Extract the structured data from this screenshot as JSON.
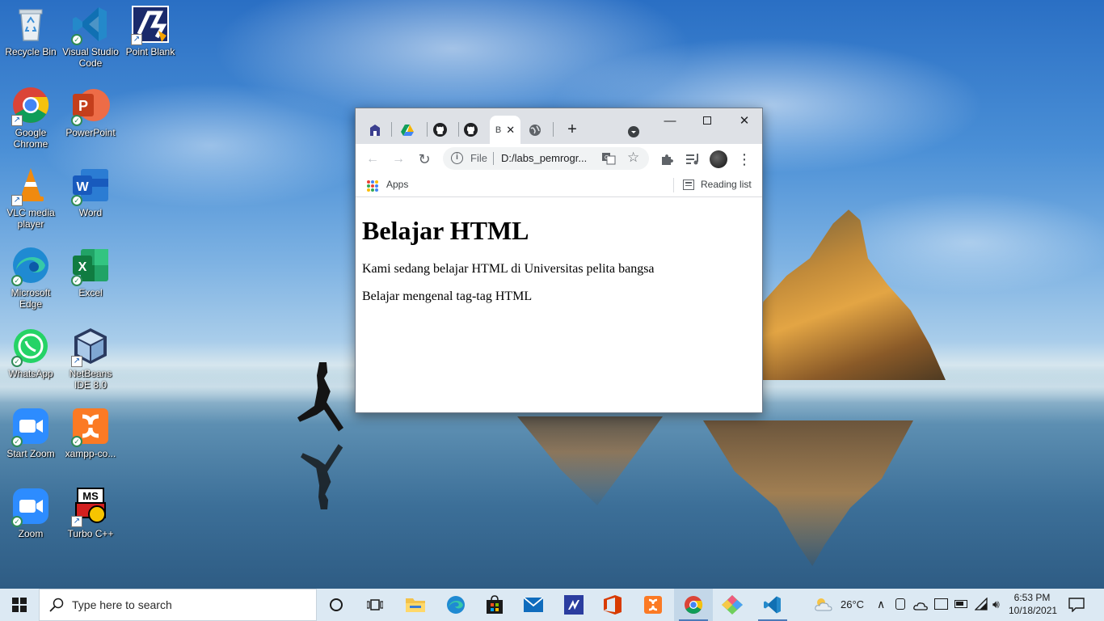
{
  "desktop": {
    "icons": [
      {
        "label": "Recycle Bin"
      },
      {
        "label": "Visual Studio Code"
      },
      {
        "label": "Point Blank"
      },
      {
        "label": "Google Chrome"
      },
      {
        "label": "PowerPoint"
      },
      {
        "label": "VLC media player"
      },
      {
        "label": "Word"
      },
      {
        "label": "Microsoft Edge"
      },
      {
        "label": "Excel"
      },
      {
        "label": "WhatsApp"
      },
      {
        "label": "NetBeans IDE 8.0"
      },
      {
        "label": "Start Zoom"
      },
      {
        "label": "xampp-co..."
      },
      {
        "label": "Zoom"
      },
      {
        "label": "Turbo C++"
      }
    ]
  },
  "browser": {
    "active_tab_label": "B",
    "toolbar": {
      "scheme": "File",
      "url": "D:/labs_pemrogr..."
    },
    "bookmarks": {
      "apps_label": "Apps",
      "reading_list_label": "Reading list"
    },
    "page": {
      "heading": "Belajar HTML",
      "paragraph1": "Kami sedang belajar HTML di Universitas pelita bangsa",
      "paragraph2": "Belajar mengenal tag-tag HTML"
    }
  },
  "taskbar": {
    "search_placeholder": "Type here to search",
    "weather": "26°C",
    "time": "6:53 PM",
    "date": "10/18/2021"
  },
  "colors": {
    "taskbar_bg": "#dce9f3",
    "tabstrip_bg": "#dee1e6",
    "accent_blue": "#1a73e8"
  }
}
